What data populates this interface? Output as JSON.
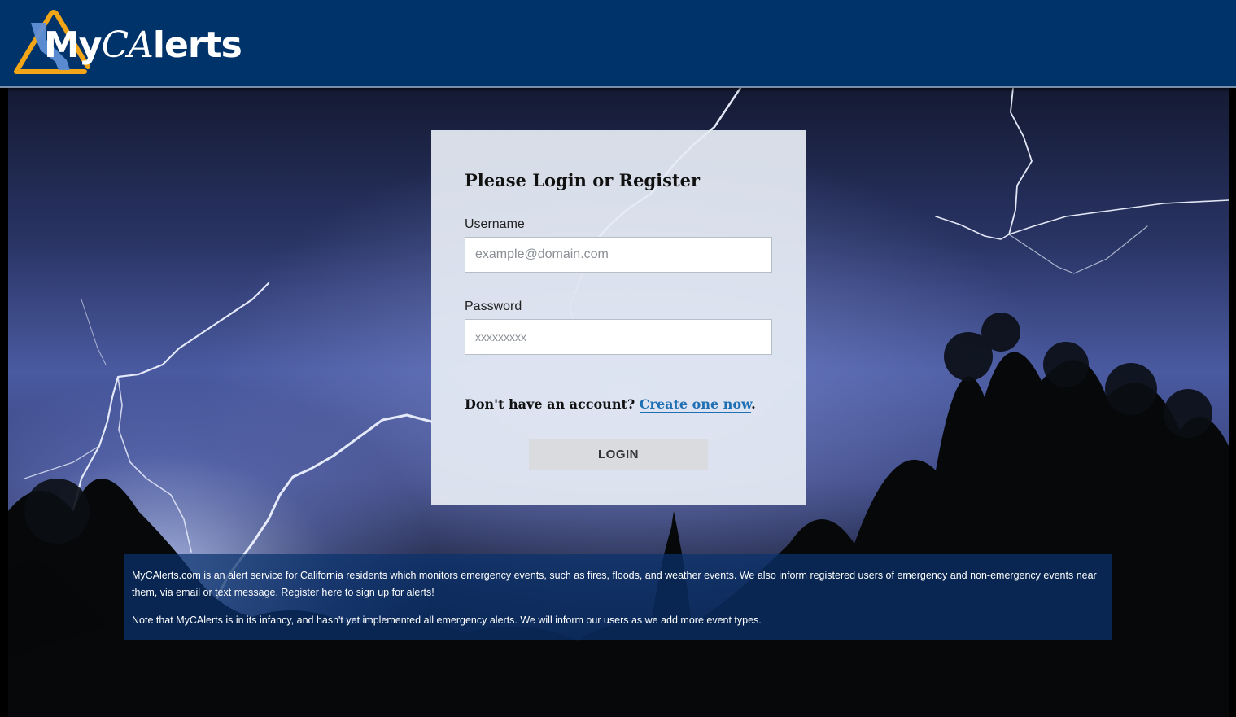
{
  "header": {
    "logo_prefix": "My",
    "logo_ca": "CA",
    "logo_suffix": "lerts",
    "background_color": "#00336a",
    "accent_color": "#f2a516"
  },
  "login": {
    "title": "Please Login or Register",
    "username_label": "Username",
    "username_placeholder": "example@domain.com",
    "password_label": "Password",
    "password_placeholder": "xxxxxxxxx",
    "register_prompt": "Don't have an account?",
    "register_link": "Create one now",
    "register_suffix": ".",
    "login_button": "LOGIN",
    "link_color": "#1f6fb5"
  },
  "info": {
    "paragraph1": "MyCAlerts.com is an alert service for California residents which monitors emergency events, such as fires, floods, and weather events. We also inform registered users of emergency and non-emergency events near them, via email or text message. Register here to sign up for alerts!",
    "paragraph2": "Note that MyCAlerts is in its infancy, and hasn't yet implemented all emergency alerts. We will inform our users as we add more event types."
  },
  "background": {
    "scene": "lightning-storm-night"
  }
}
